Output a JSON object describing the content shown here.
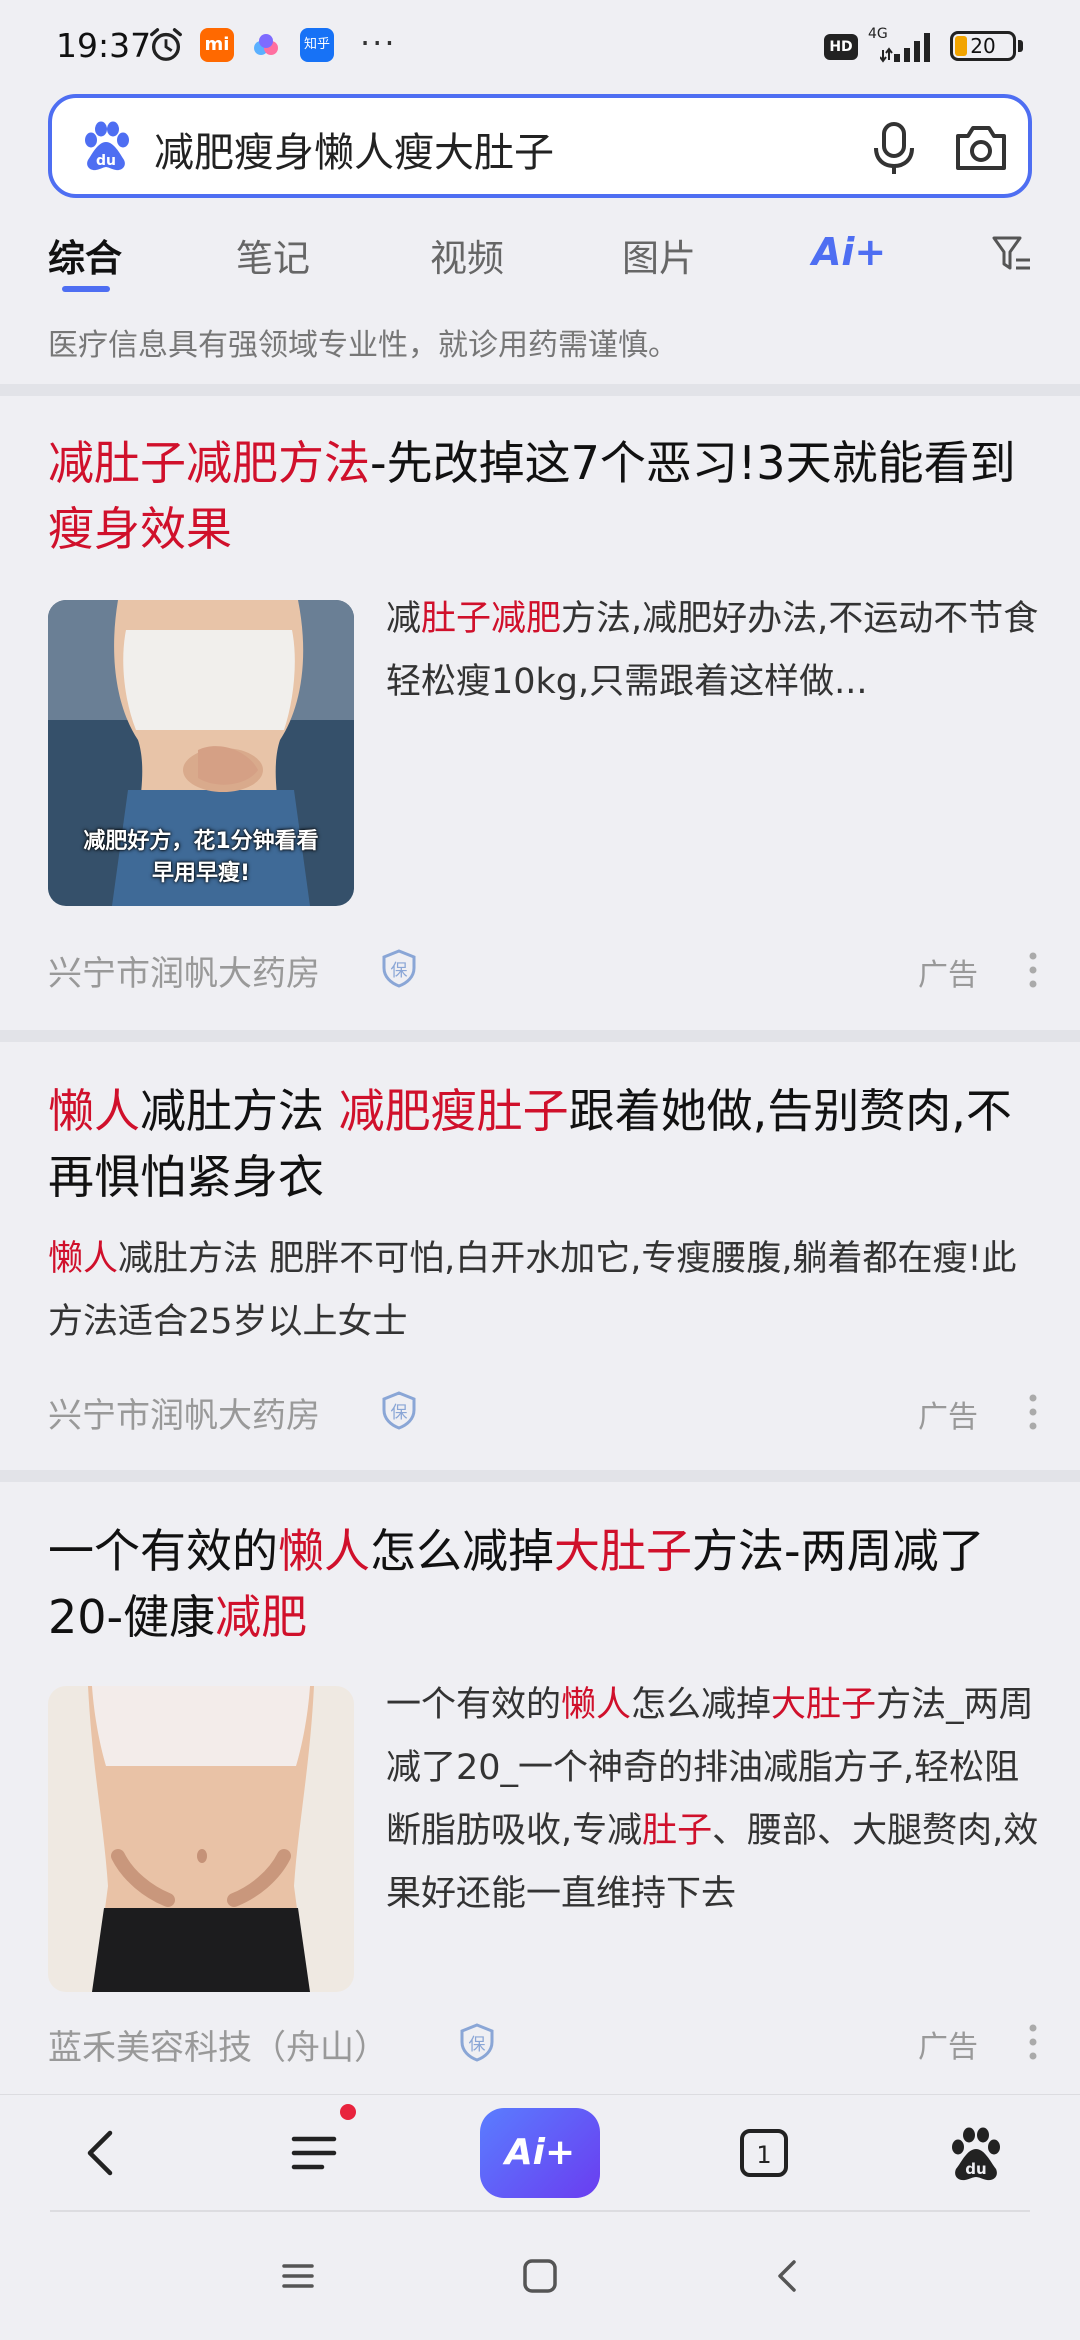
{
  "status_bar": {
    "time": "19:37",
    "mi_label": "mi",
    "zhihu_label": "知乎",
    "more": "···",
    "hd": "HD",
    "network": "4G",
    "battery": "20",
    "battery_level": 0.2
  },
  "search": {
    "query": "减肥瘦身懒人瘦大肚子",
    "brand_color": "#4e6ef2"
  },
  "tabs": [
    {
      "label": "综合",
      "active": true
    },
    {
      "label": "笔记"
    },
    {
      "label": "视频"
    },
    {
      "label": "图片"
    },
    {
      "label": "Ai+"
    }
  ],
  "notice": "医疗信息具有强领域专业性，就诊用药需谨慎。",
  "results": [
    {
      "title_parts": [
        {
          "text": "减肚子减肥方法",
          "hl": true
        },
        {
          "text": "-先改掉这7个恶习!3天就能看到"
        },
        {
          "text": "瘦身效果",
          "hl": true
        }
      ],
      "thumb_caption": [
        "减肥好方，花1分钟看看",
        "早用早瘦!"
      ],
      "desc_parts": [
        {
          "text": "减"
        },
        {
          "text": "肚子减肥",
          "hl": true
        },
        {
          "text": "方法,减肥好办法,不运动不节食轻松瘦10kg,只需跟着这样做..."
        }
      ],
      "source": "兴宁市润帆大药房",
      "badge": "保",
      "ad": "广告"
    },
    {
      "title_parts": [
        {
          "text": "懒人",
          "hl": true
        },
        {
          "text": "减肚方法 "
        },
        {
          "text": "减肥瘦肚子",
          "hl": true
        },
        {
          "text": "跟着她做,告别赘肉,不再惧怕紧身衣"
        }
      ],
      "desc_parts": [
        {
          "text": "懒人",
          "hl": true
        },
        {
          "text": "减肚方法 肥胖不可怕,白开水加它,专瘦腰腹,躺着都在瘦!此方法适合25岁以上女士"
        }
      ],
      "source": "兴宁市润帆大药房",
      "badge": "保",
      "ad": "广告"
    },
    {
      "title_parts": [
        {
          "text": "一个有效的"
        },
        {
          "text": "懒人",
          "hl": true
        },
        {
          "text": "怎么减掉"
        },
        {
          "text": "大肚子",
          "hl": true
        },
        {
          "text": "方法-两周减了20-健康"
        },
        {
          "text": "减肥",
          "hl": true
        }
      ],
      "desc_parts": [
        {
          "text": "一个有效的"
        },
        {
          "text": "懒人",
          "hl": true
        },
        {
          "text": "怎么减掉"
        },
        {
          "text": "大肚子",
          "hl": true
        },
        {
          "text": "方法_两周减了20_一个神奇的排油减脂方子,轻松阻断脂肪吸收,专减"
        },
        {
          "text": "肚子",
          "hl": true
        },
        {
          "text": "、腰部、大腿赘肉,效果好还能一直维持下去"
        }
      ],
      "source": "蓝禾美容科技（舟山）",
      "badge": "保",
      "ad": "广告"
    }
  ],
  "bottom_nav": {
    "ai_label": "Ai+",
    "tab_count": "1"
  },
  "colors": {
    "highlight": "#d0102b",
    "accent": "#4e6ef2"
  }
}
